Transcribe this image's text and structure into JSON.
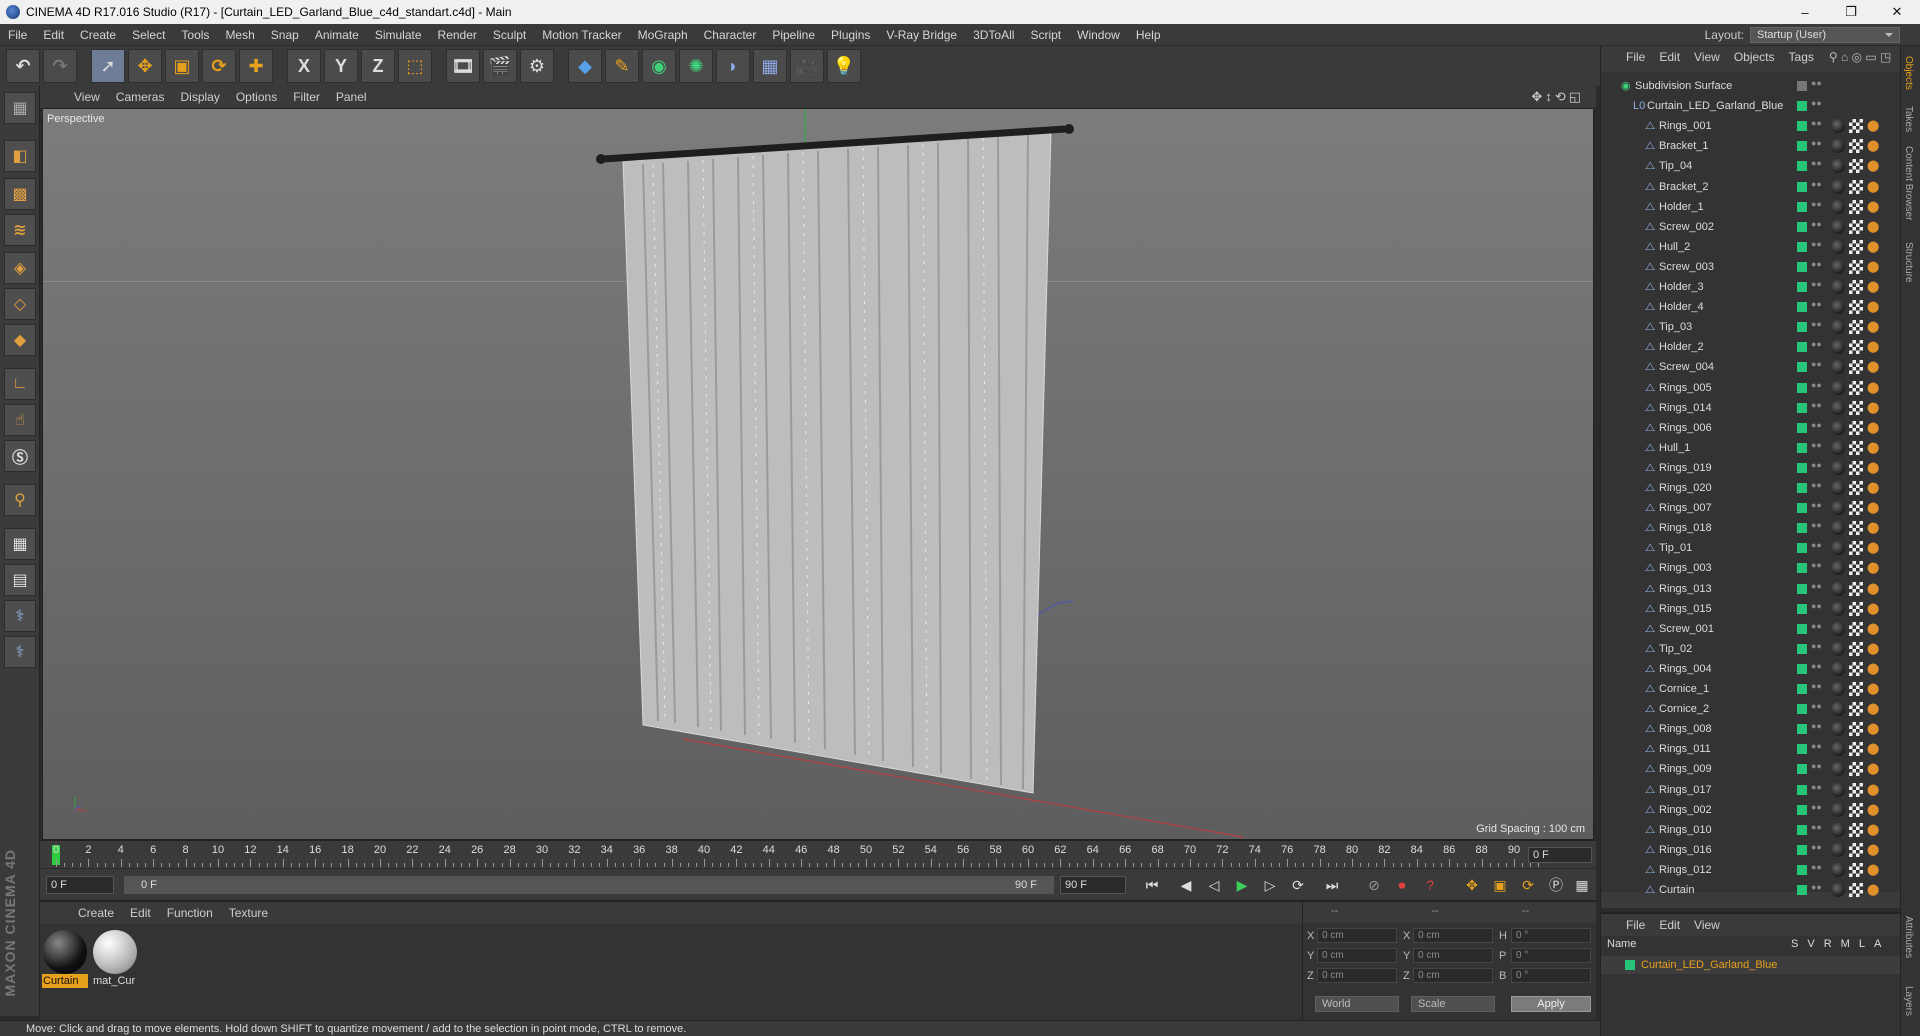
{
  "window": {
    "title": "CINEMA 4D R17.016 Studio (R17) - [Curtain_LED_Garland_Blue_c4d_standart.c4d] - Main",
    "minimize": "–",
    "maximize": "❐",
    "close": "✕"
  },
  "menubar": {
    "items": [
      "File",
      "Edit",
      "Create",
      "Select",
      "Tools",
      "Mesh",
      "Snap",
      "Animate",
      "Simulate",
      "Render",
      "Sculpt",
      "Motion Tracker",
      "MoGraph",
      "Character",
      "Pipeline",
      "Plugins",
      "V-Ray Bridge",
      "3DToAll",
      "Script",
      "Window",
      "Help"
    ],
    "layout_label": "Layout:",
    "layout_value": "Startup (User)"
  },
  "toolbar": {
    "icons": [
      "undo-icon",
      "redo-icon",
      "select-live-icon",
      "move-icon",
      "scale-icon",
      "rotate-icon",
      "move-tool-icon",
      "x-axis-icon",
      "y-axis-icon",
      "z-axis-icon",
      "coordinate-system-icon",
      "render-view-icon",
      "render-picture-icon",
      "edit-render-settings-icon",
      "cube-primitive-icon",
      "pen-spline-icon",
      "subdivision-icon",
      "array-icon",
      "deformer-icon",
      "floor-icon",
      "camera-icon",
      "light-icon"
    ],
    "axis_x": "X",
    "axis_y": "Y",
    "axis_z": "Z"
  },
  "viewport": {
    "menu": [
      "View",
      "Cameras",
      "Display",
      "Options",
      "Filter",
      "Panel"
    ],
    "label": "Perspective",
    "grid_spacing": "Grid Spacing : 100 cm"
  },
  "timeline": {
    "ticks": [
      "0",
      "2",
      "4",
      "6",
      "8",
      "10",
      "12",
      "14",
      "16",
      "18",
      "20",
      "22",
      "24",
      "26",
      "28",
      "30",
      "32",
      "34",
      "36",
      "38",
      "40",
      "42",
      "44",
      "46",
      "48",
      "50",
      "52",
      "54",
      "56",
      "58",
      "60",
      "62",
      "64",
      "66",
      "68",
      "70",
      "72",
      "74",
      "76",
      "78",
      "80",
      "82",
      "84",
      "86",
      "88",
      "90"
    ],
    "current_frame": "0 F",
    "start_field": "0 F",
    "range_start": "0 F",
    "range_end": "90 F",
    "end_field": "90 F"
  },
  "materials": {
    "menu": [
      "Create",
      "Edit",
      "Function",
      "Texture"
    ],
    "items": [
      {
        "name": "Curtain",
        "selected": true
      },
      {
        "name": "mat_Cur",
        "selected": false
      }
    ]
  },
  "coordinates": {
    "header": "--",
    "header2": "--",
    "header3": "--",
    "rows": [
      {
        "l1": "X",
        "v1": "0 cm",
        "l2": "X",
        "v2": "0 cm",
        "l3": "H",
        "v3": "0 °"
      },
      {
        "l1": "Y",
        "v1": "0 cm",
        "l2": "Y",
        "v2": "0 cm",
        "l3": "P",
        "v3": "0 °"
      },
      {
        "l1": "Z",
        "v1": "0 cm",
        "l2": "Z",
        "v2": "0 cm",
        "l3": "B",
        "v3": "0 °"
      }
    ],
    "space": "World",
    "mode": "Scale",
    "apply": "Apply"
  },
  "objects": {
    "menu": [
      "File",
      "Edit",
      "View",
      "Objects",
      "Tags"
    ],
    "root": "Subdivision Surface",
    "group": "Curtain_LED_Garland_Blue",
    "children": [
      "Rings_001",
      "Bracket_1",
      "Tip_04",
      "Bracket_2",
      "Holder_1",
      "Screw_002",
      "Hull_2",
      "Screw_003",
      "Holder_3",
      "Holder_4",
      "Tip_03",
      "Holder_2",
      "Screw_004",
      "Rings_005",
      "Rings_014",
      "Rings_006",
      "Hull_1",
      "Rings_019",
      "Rings_020",
      "Rings_007",
      "Rings_018",
      "Tip_01",
      "Rings_003",
      "Rings_013",
      "Rings_015",
      "Screw_001",
      "Tip_02",
      "Rings_004",
      "Cornice_1",
      "Cornice_2",
      "Rings_008",
      "Rings_011",
      "Rings_009",
      "Rings_017",
      "Rings_002",
      "Rings_010",
      "Rings_016",
      "Rings_012",
      "Curtain"
    ]
  },
  "layers": {
    "menu": [
      "File",
      "Edit",
      "View"
    ],
    "col_name": "Name",
    "cols": [
      "S",
      "V",
      "R",
      "M",
      "L",
      "A"
    ],
    "layer": "Curtain_LED_Garland_Blue"
  },
  "rightstrip": {
    "tabs": [
      "Objects",
      "Takes",
      "Content Browser",
      "Structure"
    ],
    "tabs2": [
      "Attributes",
      "Layers"
    ]
  },
  "branding": "MAXON CINEMA 4D",
  "status": "Move: Click and drag to move elements. Hold down SHIFT to quantize movement / add to the selection in point mode, CTRL to remove."
}
